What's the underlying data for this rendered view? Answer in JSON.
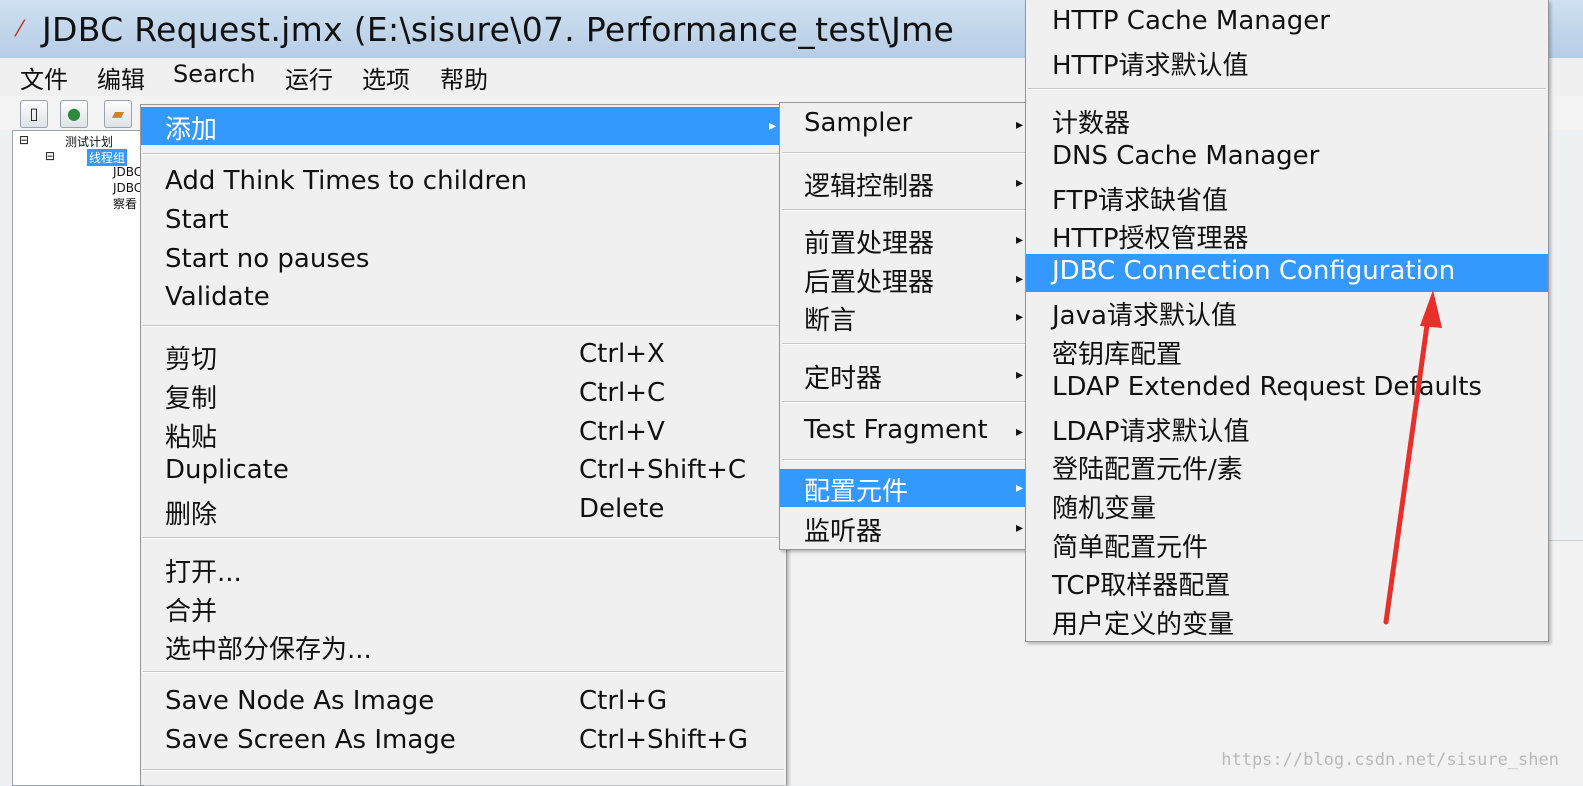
{
  "window": {
    "title": "JDBC Request.jmx (E:\\sisure\\07. Performance_test\\Jme"
  },
  "menubar": [
    "文件",
    "编辑",
    "Search",
    "运行",
    "选项",
    "帮助"
  ],
  "tree": {
    "items": [
      "测试计划",
      "线程组",
      "JDBC",
      "JDBC",
      "察看"
    ]
  },
  "context_menu": {
    "add": "添加",
    "group1": [
      "Add Think Times to children",
      "Start",
      "Start no pauses",
      "Validate"
    ],
    "edit": [
      {
        "label": "剪切",
        "shortcut": "Ctrl+X"
      },
      {
        "label": "复制",
        "shortcut": "Ctrl+C"
      },
      {
        "label": "粘贴",
        "shortcut": "Ctrl+V"
      },
      {
        "label": "Duplicate",
        "shortcut": "Ctrl+Shift+C"
      },
      {
        "label": "删除",
        "shortcut": "Delete"
      }
    ],
    "file": [
      "打开...",
      "合并",
      "选中部分保存为..."
    ],
    "image": [
      {
        "label": "Save Node As Image",
        "shortcut": "Ctrl+G"
      },
      {
        "label": "Save Screen As Image",
        "shortcut": "Ctrl+Shift+G"
      }
    ]
  },
  "add_submenu": [
    "Sampler",
    "逻辑控制器",
    "前置处理器",
    "后置处理器",
    "断言",
    "定时器",
    "Test Fragment",
    "配置元件",
    "监听器"
  ],
  "config_submenu": [
    "HTTP Cache Manager",
    "HTTP请求默认值",
    "计数器",
    "DNS Cache Manager",
    "FTP请求缺省值",
    "HTTP授权管理器",
    "JDBC Connection Configuration",
    "Java请求默认值",
    "密钥库配置",
    "LDAP Extended Request Defaults",
    "LDAP请求默认值",
    "登陆配置元件/素",
    "随机变量",
    "简单配置元件",
    "TCP取样器配置",
    "用户定义的变量"
  ],
  "watermark": "https://blog.csdn.net/sisure_shen",
  "colors": {
    "highlight": "#3399ff",
    "annotation_arrow": "#e8302b"
  }
}
